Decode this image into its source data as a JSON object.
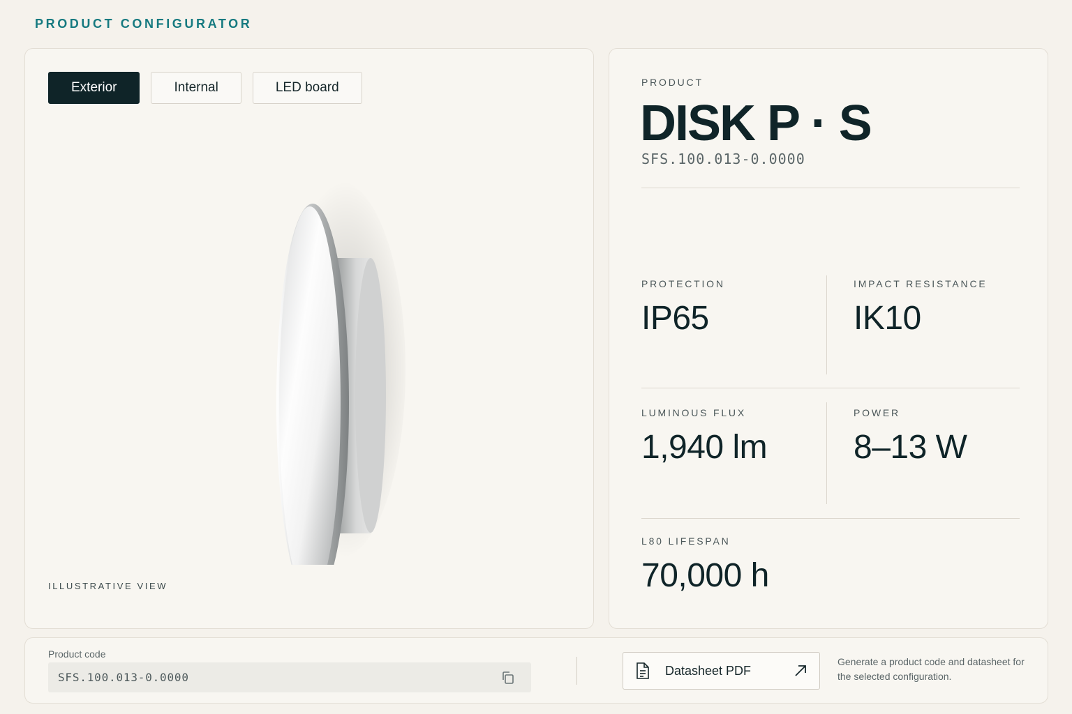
{
  "app": {
    "title": "PRODUCT CONFIGURATOR"
  },
  "viewer": {
    "tabs": [
      {
        "label": "Exterior",
        "active": true
      },
      {
        "label": "Internal",
        "active": false
      },
      {
        "label": "LED board",
        "active": false
      }
    ],
    "caption": "ILLUSTRATIVE VIEW"
  },
  "product": {
    "label": "PRODUCT",
    "name": "DISK P · S",
    "sku": "SFS.100.013-0.0000"
  },
  "specs": {
    "protection": {
      "label": "PROTECTION",
      "value": "IP65"
    },
    "impact": {
      "label": "IMPACT RESISTANCE",
      "value": "IK10"
    },
    "flux": {
      "label": "LUMINOUS FLUX",
      "value": "1,940 lm"
    },
    "power": {
      "label": "POWER",
      "value": "8–13 W"
    },
    "lifespan": {
      "label": "L80 LIFESPAN",
      "value": "70,000 h"
    }
  },
  "footer": {
    "code_label": "Product code",
    "code_value": "SFS.100.013-0.0000",
    "datasheet_label": "Datasheet PDF",
    "note": "Generate a product code and datasheet for the selected configuration."
  },
  "icons": {
    "copy": "copy-icon",
    "document": "document-icon",
    "external": "arrow-up-right-icon"
  },
  "colors": {
    "accent": "#167a80",
    "dark": "#0f2428",
    "background": "#f5f2ec"
  }
}
